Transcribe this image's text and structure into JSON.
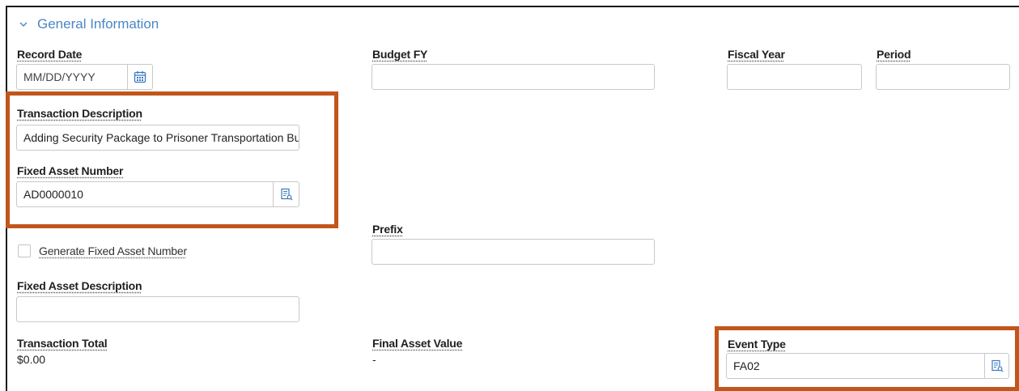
{
  "section": {
    "title": "General Information"
  },
  "fields": {
    "record_date": {
      "label": "Record Date",
      "placeholder": "MM/DD/YYYY"
    },
    "budget_fy": {
      "label": "Budget FY",
      "value": ""
    },
    "fiscal_year": {
      "label": "Fiscal Year",
      "value": ""
    },
    "period": {
      "label": "Period",
      "value": ""
    },
    "transaction_description": {
      "label": "Transaction Description",
      "value": "Adding Security Package to Prisoner Transportation Bus"
    },
    "fixed_asset_number": {
      "label": "Fixed Asset Number",
      "value": "AD0000010"
    },
    "generate_fixed_asset_number": {
      "label": "Generate Fixed Asset Number",
      "checked": false
    },
    "prefix": {
      "label": "Prefix",
      "value": ""
    },
    "fixed_asset_description": {
      "label": "Fixed Asset Description",
      "value": ""
    },
    "transaction_total": {
      "label": "Transaction Total",
      "value": "$0.00"
    },
    "final_asset_value": {
      "label": "Final Asset Value",
      "value": "-"
    },
    "event_type": {
      "label": "Event Type",
      "value": "FA02"
    }
  },
  "highlight_color": "#c1561a",
  "accent_color": "#4a86c5",
  "icons": {
    "calendar": "calendar-icon",
    "lookup": "lookup-icon",
    "chevron": "chevron-down-icon"
  }
}
